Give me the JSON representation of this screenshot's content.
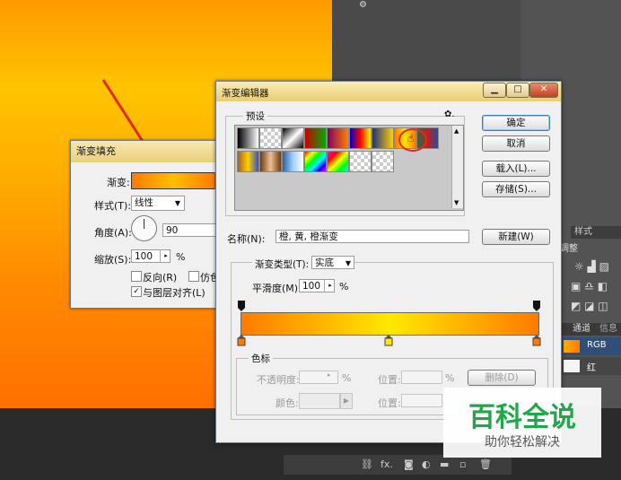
{
  "fill_dialog": {
    "title": "渐变填充",
    "gradient_label": "渐变:",
    "style_label": "样式(T):",
    "style_value": "线性",
    "angle_label": "角度(A):",
    "angle_value": "90",
    "scale_label": "缩放(S):",
    "scale_value": "100",
    "scale_unit": "%",
    "reverse_label": "反向(R)",
    "dither_label": "仿色",
    "align_label": "与图层对齐(L)",
    "align_checked": true
  },
  "editor": {
    "title": "渐变编辑器",
    "presets_label": "预设",
    "gear": "✿.",
    "ok": "确定",
    "cancel": "取消",
    "load": "载入(L)...",
    "save": "存储(S)...",
    "name_label": "名称(N):",
    "name_value": "橙, 黄, 橙渐变",
    "new_button": "新建(W)",
    "type_label": "渐变类型(T):",
    "type_value": "实底",
    "smooth_label": "平滑度(M):",
    "smooth_value": "100",
    "smooth_unit": "%",
    "stops_label": "色标",
    "opacity_label": "不透明度:",
    "opacity_unit": "%",
    "location_label": "位置:",
    "location_unit": "%",
    "delete_button": "删除(D)",
    "color_label": "颜色:",
    "location2_label": "位置:"
  },
  "panel": {
    "style_tab": "样式",
    "adjust_label": "调整",
    "channels_tab": "通道",
    "info_tab": "信息",
    "rgb_label": "RGB",
    "red_label": "红",
    "fx_label": "fx."
  },
  "watermark": {
    "title": "百科全说",
    "subtitle": "助你轻松解决"
  },
  "colors": {
    "orange": "#ff7a00",
    "yellow": "#ffe800",
    "accent": "#3b7bbf"
  }
}
